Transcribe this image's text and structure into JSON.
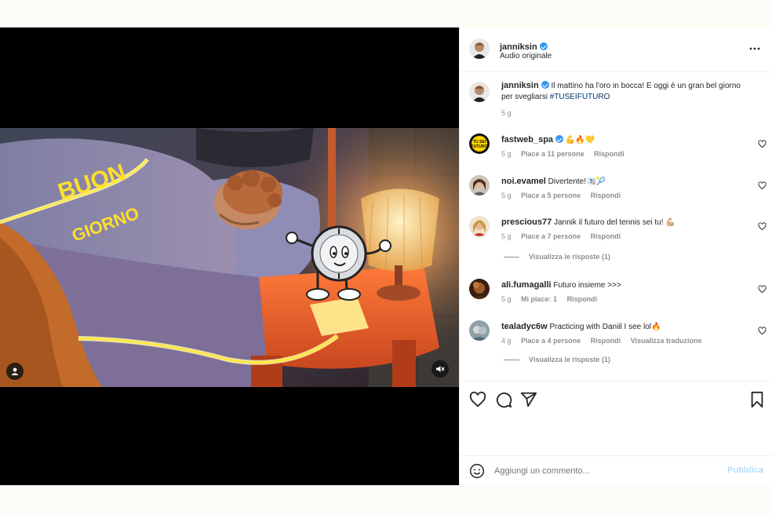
{
  "post": {
    "author": "janniksin",
    "audio": "Audio originale",
    "more_icon": "more-horizontal-icon"
  },
  "caption": {
    "author": "janniksin",
    "text": "Il mattino ha l'oro in bocca! E oggi è un gran bel giorno per svegliarsi",
    "hashtag": "#TUSEIFUTURO",
    "time": "5 g"
  },
  "video": {
    "overlay_text_1": "BUON",
    "overlay_text_2": "GIORNO"
  },
  "comments": [
    {
      "user": "fastweb_spa",
      "verified": true,
      "text": "💪🔥💛",
      "time": "5 g",
      "likes": "Piace a 11 persone",
      "reply": "Rispondi"
    },
    {
      "user": "noi.evamel",
      "verified": false,
      "text": "Divertente!🇹🇮🎾",
      "time": "5 g",
      "likes": "Piace a 5 persone",
      "reply": "Rispondi"
    },
    {
      "user": "prescious77",
      "verified": false,
      "text": "Jannik il futuro del tennis sei tu! 💪🏼",
      "time": "5 g",
      "likes": "Piace a 7 persone",
      "reply": "Rispondi",
      "view_replies": "Visualizza le risposte (1)"
    },
    {
      "user": "ali.fumagalli",
      "verified": false,
      "text": "Futuro insieme >>>",
      "time": "5 g",
      "likes": "Mi piace: 1",
      "reply": "Rispondi"
    },
    {
      "user": "tealadyc6w",
      "verified": false,
      "text": "Practicing with Daniil I see lol🔥",
      "time": "4 g",
      "likes": "Piace a 4 persone",
      "reply": "Rispondi",
      "translate": "Visualizza traduzione",
      "view_replies": "Visualizza le risposte (1)"
    }
  ],
  "add_comment": {
    "placeholder": "Aggiungi un commento...",
    "publish": "Pubblica"
  },
  "colors": {
    "link": "#00376b",
    "verified": "#3897f0",
    "publish_disabled": "#b2dffc",
    "meta": "#8e8e8e"
  }
}
